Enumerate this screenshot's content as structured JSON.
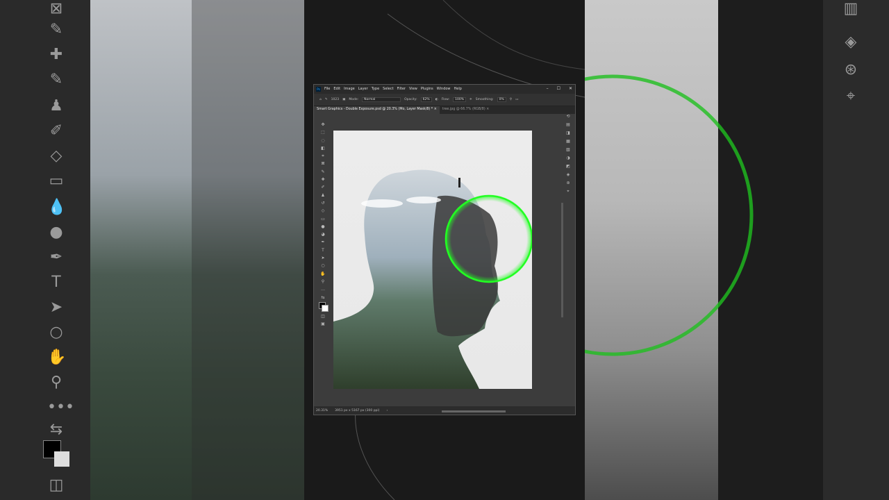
{
  "app": {
    "name": "Ps"
  },
  "menu": [
    "File",
    "Edit",
    "Image",
    "Layer",
    "Type",
    "Select",
    "Filter",
    "View",
    "Plugins",
    "Window",
    "Help"
  ],
  "window_controls": {
    "minimize": "–",
    "maximize": "☐",
    "close": "✕"
  },
  "options": {
    "brush_size": "1023",
    "mode_label": "Mode:",
    "mode_value": "Normal",
    "opacity_label": "Opacity:",
    "opacity_value": "62%",
    "flow_label": "Flow:",
    "flow_value": "100%",
    "smoothing_label": "Smoothing:",
    "smoothing_value": "0%"
  },
  "tabs": [
    {
      "label": "Smart Graphics - Double Exposure.psd @ 20.3% (Mo, Layer Mask/8) *",
      "close": "×"
    },
    {
      "label": "tree.jpg @ 66.7% (RGB/8)",
      "close": "×"
    }
  ],
  "status": {
    "zoom": "20.31%",
    "dimensions": "3951 px x 5167 px (300 ppi)",
    "arrow": "›"
  },
  "colors": {
    "accent_ring": "#22ff22",
    "canvas_bg": "#ececec",
    "ps_bg": "#3c3c3c"
  },
  "tool_icons": [
    "move-icon",
    "marquee-icon",
    "lasso-icon",
    "object-select-icon",
    "crop-icon",
    "frame-icon",
    "eyedropper-icon",
    "healing-icon",
    "brush-icon",
    "clone-stamp-icon",
    "history-brush-icon",
    "eraser-icon",
    "gradient-icon",
    "blur-icon",
    "dodge-icon",
    "pen-icon",
    "type-icon",
    "path-select-icon",
    "shape-icon",
    "hand-icon",
    "zoom-icon",
    "more-icon"
  ],
  "type_glyph": "T"
}
